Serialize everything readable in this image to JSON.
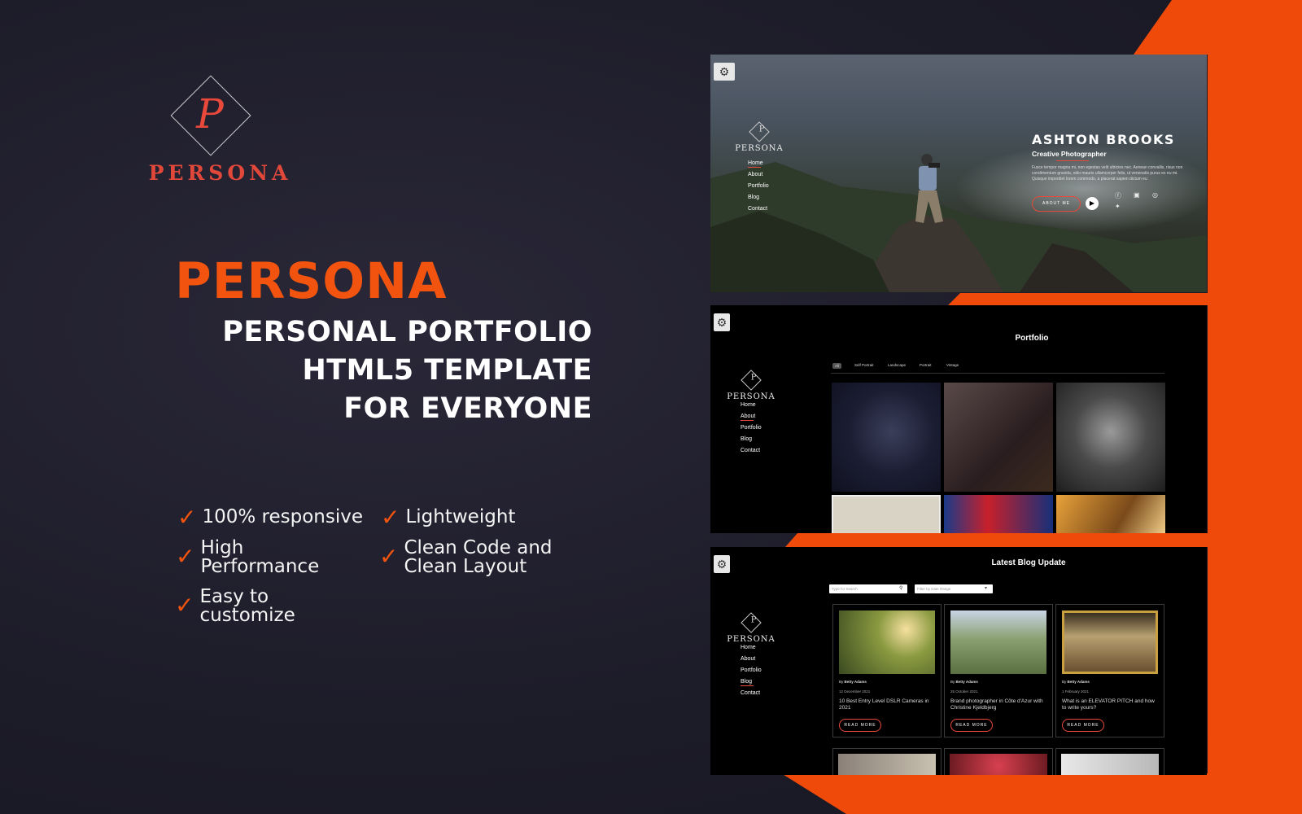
{
  "brand": {
    "logo_letter": "P",
    "logo_word": "PERSONA",
    "accent": "#f2540f",
    "logo_red": "#e2483a"
  },
  "headline": {
    "title": "PERSONA",
    "subtitle_lines": [
      "PERSONAL PORTFOLIO",
      "HTML5 TEMPLATE",
      "FOR EVERYONE"
    ]
  },
  "features": [
    {
      "icon": "check-icon",
      "line1": "100% responsive",
      "line2": ""
    },
    {
      "icon": "check-icon",
      "line1": "Lightweight",
      "line2": ""
    },
    {
      "icon": "check-icon",
      "line1": "High",
      "line2": "Performance"
    },
    {
      "icon": "check-icon",
      "line1": "Clean Code and",
      "line2": "Clean Layout"
    },
    {
      "icon": "check-icon",
      "line1": "Easy to",
      "line2": "customize"
    }
  ],
  "screen_hero": {
    "gear_icon": "settings-gear-icon",
    "logo_letter": "P",
    "logo_word": "PERSONA",
    "nav": [
      "Home",
      "About",
      "Portfolio",
      "Blog",
      "Contact"
    ],
    "active_nav": "Home",
    "name": "ASHTON BROOKS",
    "role": "Creative Photographer",
    "text": "Fusce tempor magna mi, non egestas velit ultricies nec. Aenean convallis, risus non condimentum gravida, odio mauris ullamcorper felis, ut venenatis purus ex eu mi. Quisque imperdiet lorem commodo, a placerat sapien dictum eu",
    "about_button": "ABOUT ME",
    "play_icon": "play-icon",
    "social_icons": [
      "facebook-icon",
      "linkedin-icon",
      "instagram-icon",
      "twitter-icon"
    ]
  },
  "screen_portfolio": {
    "logo_letter": "P",
    "logo_word": "PERSONA",
    "nav": [
      "Home",
      "About",
      "Portfolio",
      "Blog",
      "Contact"
    ],
    "active_nav": "About",
    "title": "Portfolio",
    "filters": [
      "All",
      "Self Portrait",
      "Landscape",
      "Portrait",
      "Vintage"
    ]
  },
  "screen_blog": {
    "logo_letter": "P",
    "logo_word": "PERSONA",
    "nav": [
      "Home",
      "About",
      "Portfolio",
      "Blog",
      "Contact"
    ],
    "active_nav": "Blog",
    "title": "Latest Blog Update",
    "search_placeholder": "Type for Search",
    "filter_placeholder": "Filter by Date Range",
    "cards": [
      {
        "by": "By",
        "author": "Betty Adams",
        "date": "12 December 2021",
        "title": "10 Best Entry Level DSLR Cameras in 2021",
        "button": "READ MORE"
      },
      {
        "by": "By",
        "author": "Betty Adams",
        "date": "25 October 2021",
        "title": "Brand photographer in Côte d'Azur with Christine Kjeldbjerg",
        "button": "READ MORE"
      },
      {
        "by": "By",
        "author": "Betty Adams",
        "date": "1 February 2021",
        "title": "What is an ELEVATOR PITCH and how to write yours?",
        "button": "READ MORE"
      }
    ]
  }
}
